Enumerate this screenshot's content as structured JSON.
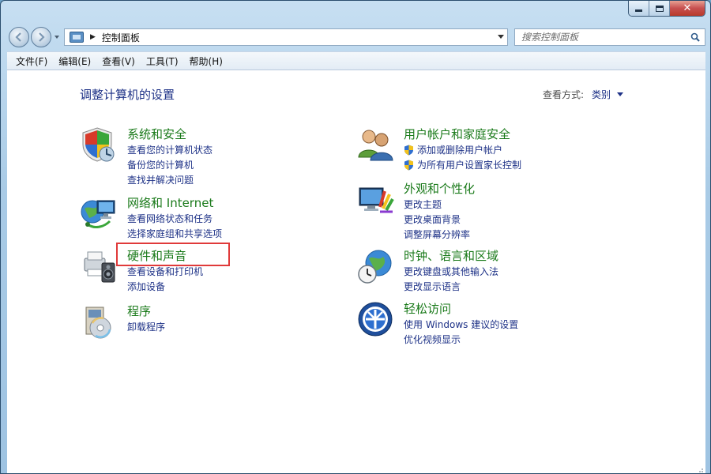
{
  "window": {
    "caption": {
      "minimize": "–",
      "maximize": "□",
      "close": "✕"
    }
  },
  "address": {
    "path": "控制面板",
    "separator": "▶"
  },
  "search": {
    "placeholder": "搜索控制面板"
  },
  "menu": {
    "items": [
      "文件(F)",
      "编辑(E)",
      "查看(V)",
      "工具(T)",
      "帮助(H)"
    ]
  },
  "page": {
    "title": "调整计算机的设置",
    "viewby_label": "查看方式:",
    "viewby_value": "类别"
  },
  "categories": [
    {
      "title": "系统和安全",
      "icon": "system-security-icon",
      "links": [
        "查看您的计算机状态",
        "备份您的计算机",
        "查找并解决问题"
      ]
    },
    {
      "title": "网络和 Internet",
      "icon": "network-internet-icon",
      "links": [
        "查看网络状态和任务",
        "选择家庭组和共享选项"
      ]
    },
    {
      "title": "硬件和声音",
      "icon": "hardware-sound-icon",
      "links": [
        "查看设备和打印机",
        "添加设备"
      ]
    },
    {
      "title": "程序",
      "icon": "programs-icon",
      "links": [
        "卸载程序"
      ]
    },
    {
      "title": "用户帐户和家庭安全",
      "icon": "user-accounts-icon",
      "links": [
        "添加或删除用户帐户",
        "为所有用户设置家长控制"
      ],
      "shielded": true
    },
    {
      "title": "外观和个性化",
      "icon": "appearance-icon",
      "links": [
        "更改主题",
        "更改桌面背景",
        "调整屏幕分辨率"
      ]
    },
    {
      "title": "时钟、语言和区域",
      "icon": "clock-language-icon",
      "links": [
        "更改键盘或其他输入法",
        "更改显示语言"
      ]
    },
    {
      "title": "轻松访问",
      "icon": "ease-of-access-icon",
      "links": [
        "使用 Windows 建议的设置",
        "优化视频显示"
      ]
    }
  ],
  "colors": {
    "category_title": "#1a7a1a",
    "link": "#1e3287",
    "highlight": "#e03a3a"
  }
}
